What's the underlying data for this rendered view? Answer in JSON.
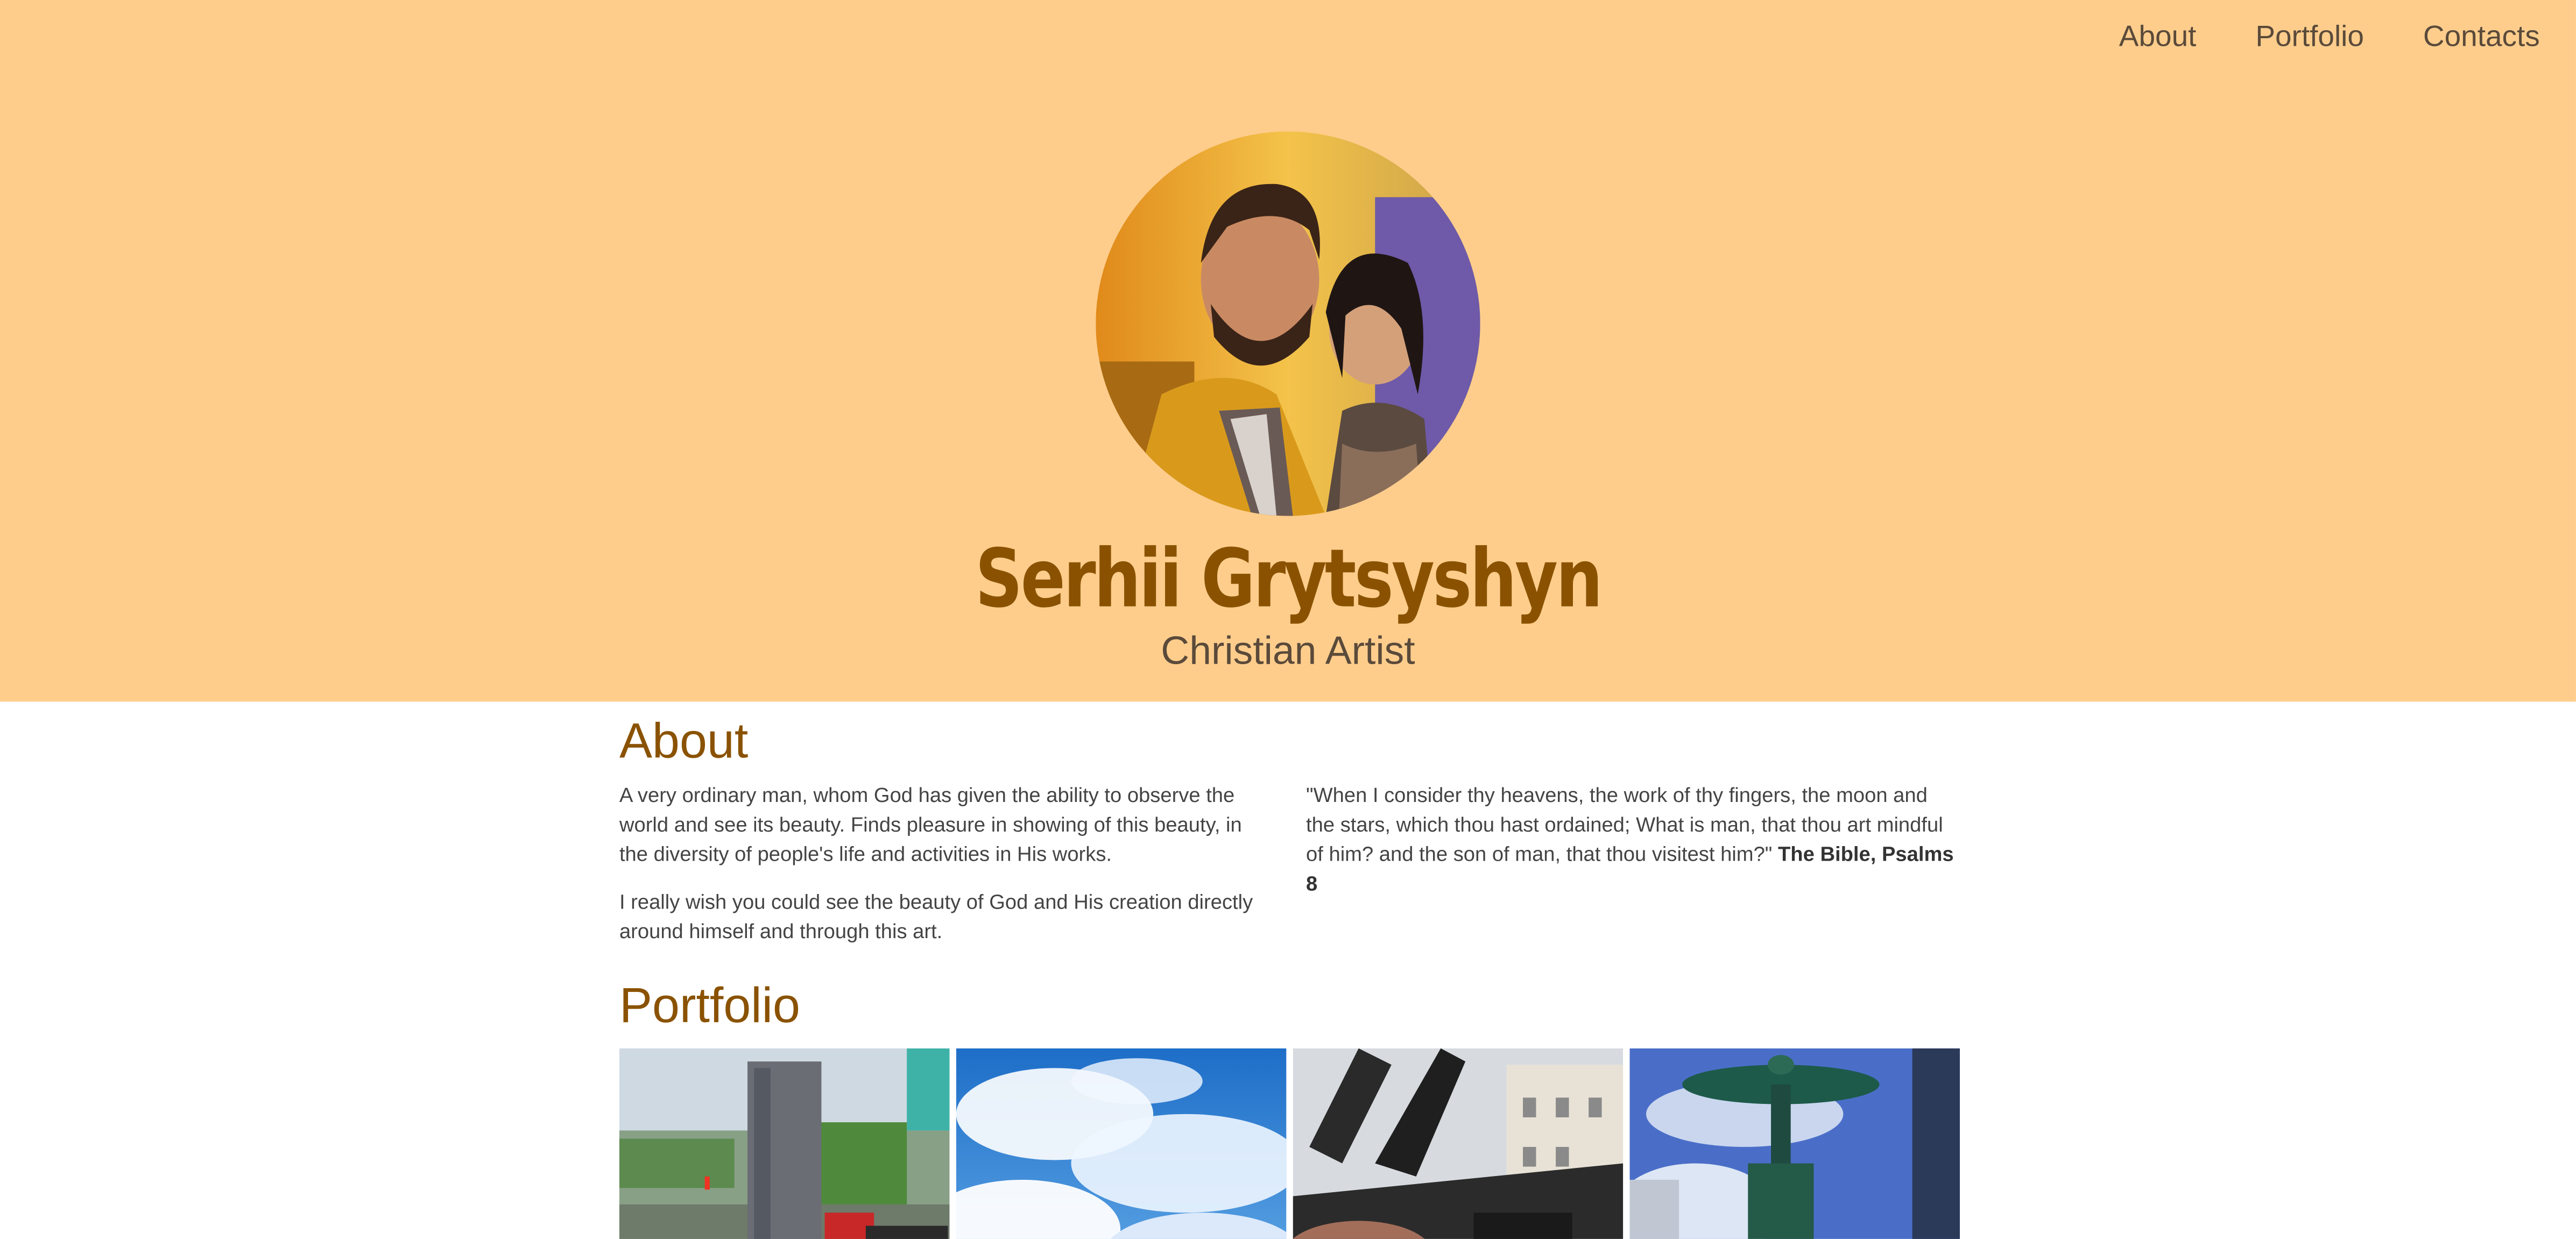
{
  "nav": {
    "items": [
      {
        "label": "About"
      },
      {
        "label": "Portfolio"
      },
      {
        "label": "Contacts"
      }
    ]
  },
  "header": {
    "name": "Serhii Grytsyshyn",
    "subtitle": "Christian Artist"
  },
  "about": {
    "title": "About",
    "paragraphs": [
      "A very ordinary man, whom God has given the ability to observe the world and see its beauty. Finds pleasure in showing of this beauty, in the diversity of people's life and activities in His works.",
      "I really wish you could see the beauty of God and His creation directly around himself and through this art."
    ],
    "quote": "\"When I consider thy heavens, the work of thy fingers, the moon and the stars, which thou hast ordained; What is man, that thou art mindful of him? and the son of man, that thou visitest him?\"",
    "quote_source": "The Bible, Psalms 8"
  },
  "portfolio": {
    "title": "Portfolio"
  },
  "colors": {
    "header_bg": "#fecd8c",
    "accent": "#8a5200",
    "text": "#444444"
  }
}
